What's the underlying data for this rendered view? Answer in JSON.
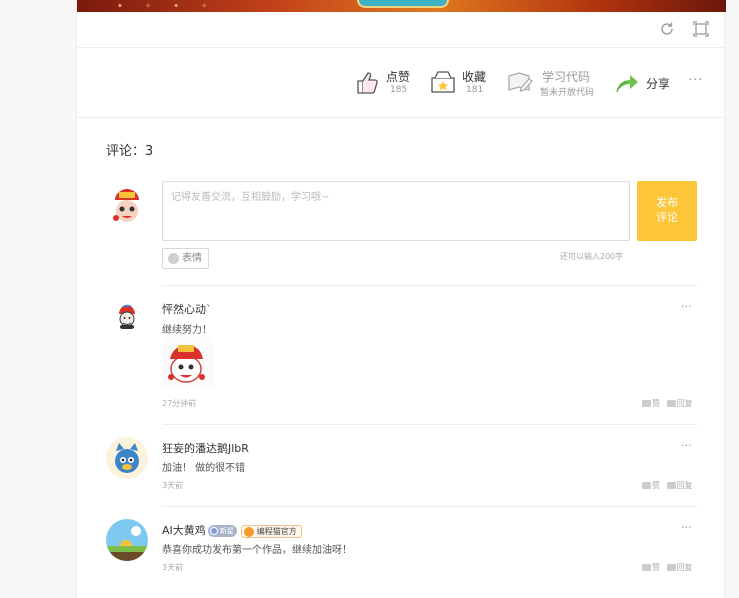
{
  "actions": {
    "like": {
      "label": "点赞",
      "count": "185"
    },
    "favorite": {
      "label": "收藏",
      "count": "181"
    },
    "code": {
      "label": "学习代码",
      "sub": "暂未开放代码"
    },
    "share": {
      "label": "分享"
    },
    "more": "···"
  },
  "comments_header": "评论：3",
  "composer": {
    "placeholder": "记得友善交流，互相鼓励，学习哦~",
    "publish_line1": "发布",
    "publish_line2": "评论",
    "emoji_label": "表情",
    "remaining": "还可以输入200字"
  },
  "comments": [
    {
      "name": "怦然心动`",
      "text": "继续努力！",
      "time": "27分钟前",
      "like": "赞",
      "reply": "回复"
    },
    {
      "name": "狂妄的潘达鹅JlbR",
      "text": "加油！ 做的很不错",
      "time": "3天前",
      "like": "赞",
      "reply": "回复"
    },
    {
      "name": "AI大黄鸡",
      "badge1": "新星",
      "badge2": "编程猫官方",
      "text": "恭喜你成功发布第一个作品，继续加油呀！",
      "time": "3天前",
      "like": "赞",
      "reply": "回复"
    }
  ],
  "more_icon": "···",
  "colors": {
    "accent": "#fcc53a",
    "share_green": "#6cc24a"
  },
  "icons": [
    "refresh-icon",
    "fullscreen-icon",
    "thumbs-up-icon",
    "favorite-box-icon",
    "code-book-icon",
    "share-arrow-icon",
    "emoji-icon"
  ]
}
